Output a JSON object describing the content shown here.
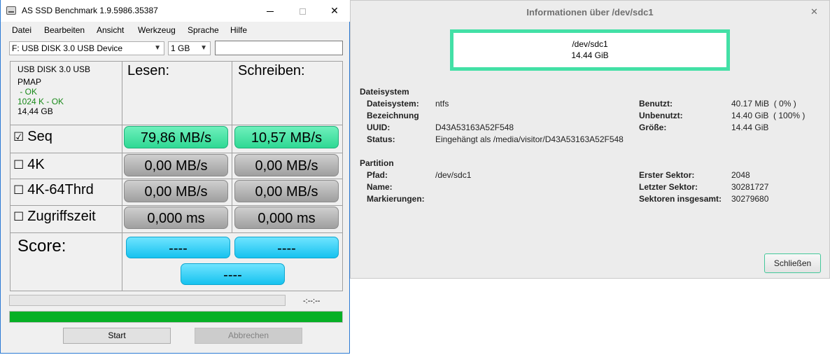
{
  "asssd": {
    "title": "AS SSD Benchmark 1.9.5986.35387",
    "menu": [
      "Datei",
      "Bearbeiten",
      "Ansicht",
      "Werkzeug",
      "Sprache",
      "Hilfe"
    ],
    "drive_select": "F: USB DISK 3.0 USB Device",
    "size_select": "1 GB",
    "device_info": {
      "name": "USB DISK 3.0 USB",
      "line2": "PMAP",
      "ok1": " - OK",
      "ok2": "1024 K - OK",
      "size": "14,44 GB"
    },
    "columns": {
      "read": "Lesen:",
      "write": "Schreiben:"
    },
    "rows": [
      {
        "checkbox": "☑",
        "label": "Seq",
        "read": "79,86 MB/s",
        "write": "10,57 MB/s"
      },
      {
        "checkbox": "☐",
        "label": "4K",
        "read": "0,00 MB/s",
        "write": "0,00 MB/s"
      },
      {
        "checkbox": "☐",
        "label": "4K-64Thrd",
        "read": "0,00 MB/s",
        "write": "0,00 MB/s"
      },
      {
        "checkbox": "☐",
        "label": "Zugriffszeit",
        "read": "0,000 ms",
        "write": "0,000 ms"
      }
    ],
    "score": {
      "label": "Score:",
      "read": "----",
      "write": "----",
      "total": "----"
    },
    "timer": "-:--:--",
    "progress_fraction": 1.0,
    "buttons": {
      "start": "Start",
      "abort": "Abbrechen"
    },
    "colors": {
      "green": "#06b025",
      "result_green": "#2fd894",
      "score_blue": "#16c2ef"
    }
  },
  "info_dialog": {
    "title": "Informationen über /dev/sdc1",
    "close_glyph": "✕",
    "device": {
      "path": "/dev/sdc1",
      "size": "14.44 GiB"
    },
    "filesystem": {
      "heading": "Dateisystem",
      "left": [
        {
          "label": "Dateisystem:",
          "value": "ntfs"
        },
        {
          "label": "Bezeichnung",
          "value": ""
        },
        {
          "label": "UUID:",
          "value": "D43A53163A52F548"
        },
        {
          "label": "Status:",
          "value": "Eingehängt als /media/visitor/D43A53163A52F548"
        }
      ],
      "right": [
        {
          "label": "Benutzt:",
          "value": "40.17 MiB  ( 0% )"
        },
        {
          "label": "Unbenutzt:",
          "value": "14.40 GiB  ( 100% )"
        },
        {
          "label": "Größe:",
          "value": "14.44 GiB"
        }
      ]
    },
    "partition": {
      "heading": "Partition",
      "left": [
        {
          "label": "Pfad:",
          "value": "/dev/sdc1"
        },
        {
          "label": "Name:",
          "value": ""
        },
        {
          "label": "Markierungen:",
          "value": ""
        }
      ],
      "right": [
        {
          "label": "Erster Sektor:",
          "value": "2048"
        },
        {
          "label": "Letzter Sektor:",
          "value": "30281727"
        },
        {
          "label": "Sektoren insgesamt:",
          "value": "30279680"
        }
      ]
    },
    "close_button": "Schließen",
    "accent": "#43e0a6"
  }
}
